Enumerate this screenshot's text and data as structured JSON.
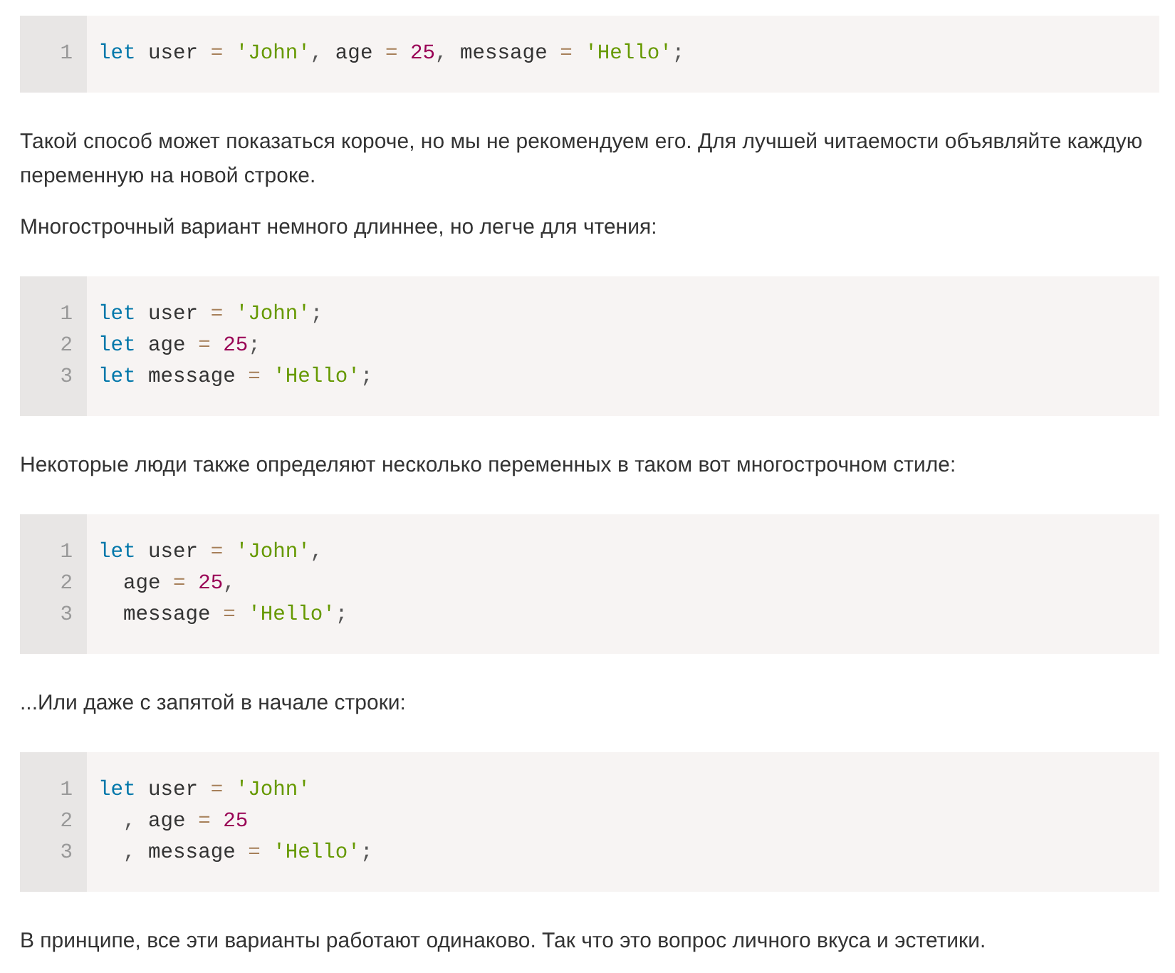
{
  "content": [
    {
      "kind": "code",
      "lines": [
        [
          {
            "kind": "keyword",
            "text": "let"
          },
          {
            "kind": "plain",
            "text": " user"
          },
          {
            "kind": "operator",
            "text": " = "
          },
          {
            "kind": "string",
            "text": "'John'"
          },
          {
            "kind": "punct",
            "text": ","
          },
          {
            "kind": "plain",
            "text": " age"
          },
          {
            "kind": "operator",
            "text": " = "
          },
          {
            "kind": "number",
            "text": "25"
          },
          {
            "kind": "punct",
            "text": ","
          },
          {
            "kind": "plain",
            "text": " message"
          },
          {
            "kind": "operator",
            "text": " = "
          },
          {
            "kind": "string",
            "text": "'Hello'"
          },
          {
            "kind": "punct",
            "text": ";"
          }
        ]
      ],
      "numbers": [
        "1"
      ]
    },
    {
      "kind": "paragraph",
      "text": "Такой способ может показаться короче, но мы не рекомендуем его. Для лучшей читаемости объявляйте каждую переменную на новой строке."
    },
    {
      "kind": "paragraph",
      "text": "Многострочный вариант немного длиннее, но легче для чтения:"
    },
    {
      "kind": "code",
      "lines": [
        [
          {
            "kind": "keyword",
            "text": "let"
          },
          {
            "kind": "plain",
            "text": " user"
          },
          {
            "kind": "operator",
            "text": " = "
          },
          {
            "kind": "string",
            "text": "'John'"
          },
          {
            "kind": "punct",
            "text": ";"
          }
        ],
        [
          {
            "kind": "keyword",
            "text": "let"
          },
          {
            "kind": "plain",
            "text": " age"
          },
          {
            "kind": "operator",
            "text": " = "
          },
          {
            "kind": "number",
            "text": "25"
          },
          {
            "kind": "punct",
            "text": ";"
          }
        ],
        [
          {
            "kind": "keyword",
            "text": "let"
          },
          {
            "kind": "plain",
            "text": " message"
          },
          {
            "kind": "operator",
            "text": " = "
          },
          {
            "kind": "string",
            "text": "'Hello'"
          },
          {
            "kind": "punct",
            "text": ";"
          }
        ]
      ],
      "numbers": [
        "1",
        "2",
        "3"
      ]
    },
    {
      "kind": "paragraph",
      "text": "Некоторые люди также определяют несколько переменных в таком вот многострочном стиле:"
    },
    {
      "kind": "code",
      "lines": [
        [
          {
            "kind": "keyword",
            "text": "let"
          },
          {
            "kind": "plain",
            "text": " user"
          },
          {
            "kind": "operator",
            "text": " = "
          },
          {
            "kind": "string",
            "text": "'John'"
          },
          {
            "kind": "punct",
            "text": ","
          }
        ],
        [
          {
            "kind": "plain",
            "text": "  age"
          },
          {
            "kind": "operator",
            "text": " = "
          },
          {
            "kind": "number",
            "text": "25"
          },
          {
            "kind": "punct",
            "text": ","
          }
        ],
        [
          {
            "kind": "plain",
            "text": "  message"
          },
          {
            "kind": "operator",
            "text": " = "
          },
          {
            "kind": "string",
            "text": "'Hello'"
          },
          {
            "kind": "punct",
            "text": ";"
          }
        ]
      ],
      "numbers": [
        "1",
        "2",
        "3"
      ]
    },
    {
      "kind": "paragraph",
      "text": "...Или даже с запятой в начале строки:"
    },
    {
      "kind": "code",
      "lines": [
        [
          {
            "kind": "keyword",
            "text": "let"
          },
          {
            "kind": "plain",
            "text": " user"
          },
          {
            "kind": "operator",
            "text": " = "
          },
          {
            "kind": "string",
            "text": "'John'"
          }
        ],
        [
          {
            "kind": "punct",
            "text": "  ,"
          },
          {
            "kind": "plain",
            "text": " age"
          },
          {
            "kind": "operator",
            "text": " = "
          },
          {
            "kind": "number",
            "text": "25"
          }
        ],
        [
          {
            "kind": "punct",
            "text": "  ,"
          },
          {
            "kind": "plain",
            "text": " message"
          },
          {
            "kind": "operator",
            "text": " = "
          },
          {
            "kind": "string",
            "text": "'Hello'"
          },
          {
            "kind": "punct",
            "text": ";"
          }
        ]
      ],
      "numbers": [
        "1",
        "2",
        "3"
      ]
    },
    {
      "kind": "paragraph",
      "text": "В принципе, все эти варианты работают одинаково. Так что это вопрос личного вкуса и эстетики."
    }
  ]
}
